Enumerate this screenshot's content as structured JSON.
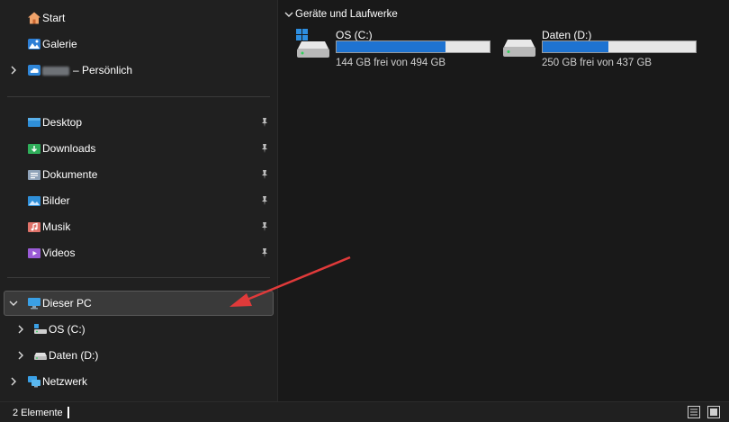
{
  "sidebar": {
    "top_items": [
      {
        "label": "Start"
      },
      {
        "label": "Galerie"
      },
      {
        "label": "– Persönlich"
      }
    ],
    "quick_access": [
      {
        "label": "Desktop"
      },
      {
        "label": "Downloads"
      },
      {
        "label": "Dokumente"
      },
      {
        "label": "Bilder"
      },
      {
        "label": "Musik"
      },
      {
        "label": "Videos"
      }
    ],
    "this_pc": {
      "label": "Dieser PC",
      "children": [
        {
          "label": "OS (C:)"
        },
        {
          "label": "Daten (D:)"
        }
      ]
    },
    "network": {
      "label": "Netzwerk"
    }
  },
  "main": {
    "section_title": "Geräte und Laufwerke",
    "drives": [
      {
        "label": "OS (C:)",
        "free_text": "144 GB frei von 494 GB",
        "used_fraction": 0.71
      },
      {
        "label": "Daten (D:)",
        "free_text": "250 GB frei von 437 GB",
        "used_fraction": 0.43
      }
    ]
  },
  "status": {
    "item_count": "2 Elemente"
  },
  "colors": {
    "accent": "#1e73d1",
    "arrow": "#e03a3a"
  }
}
